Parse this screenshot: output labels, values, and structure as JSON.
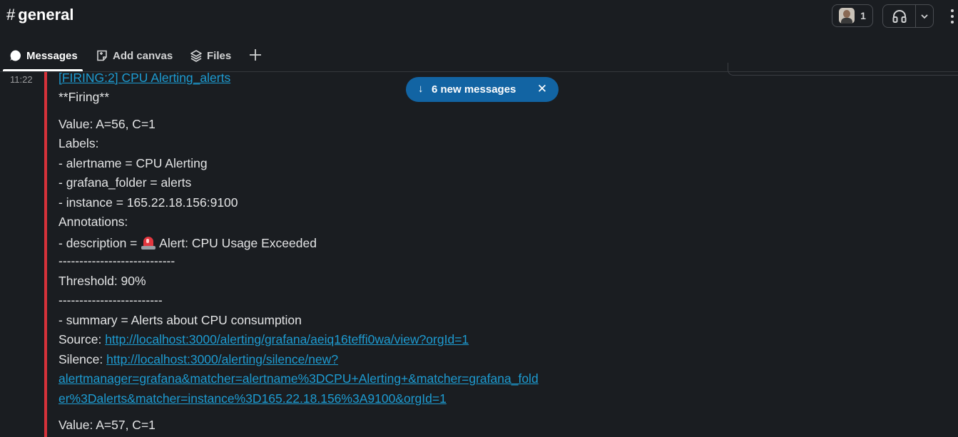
{
  "header": {
    "channel_hash": "#",
    "channel_name": "general",
    "member_count": "1"
  },
  "tabs": [
    {
      "label": "Messages",
      "icon": "message-bubble-icon",
      "active": true
    },
    {
      "label": "Add canvas",
      "icon": "canvas-icon",
      "active": false
    },
    {
      "label": "Files",
      "icon": "files-stack-icon",
      "active": false
    }
  ],
  "new_messages_pill": {
    "arrow": "↓",
    "label": "6 new messages",
    "close": "✕"
  },
  "message": {
    "timestamp": "11:22",
    "title": "[FIRING:2] CPU Alerting_alerts",
    "firing": "**Firing**",
    "value1": "Value: A=56, C=1",
    "labels_heading": "Labels:",
    "label_alertname": "- alertname = CPU Alerting",
    "label_folder": "- grafana_folder = alerts",
    "label_instance": "- instance = 165.22.18.156:9100",
    "annotations_heading": "Annotations:",
    "description_prefix": "- description = ",
    "description_text": " Alert: CPU Usage Exceeded",
    "divider1": "----------------------------",
    "threshold": "Threshold: 90%",
    "divider2": "-------------------------",
    "summary": "- summary = Alerts about CPU consumption",
    "source_label": "Source: ",
    "source_url": "http://localhost:3000/alerting/grafana/aeiq16teffi0wa/view?orgId=1",
    "silence_label": "Silence: ",
    "silence_url_1": "http://localhost:3000/alerting/silence/new?",
    "silence_url_2": "alertmanager=grafana&matcher=alertname%3DCPU+Alerting+&matcher=grafana_fold",
    "silence_url_3": "er%3Dalerts&matcher=instance%3D165.22.18.156%3A9100&orgId=1",
    "value2": "Value: A=57, C=1"
  },
  "colors": {
    "background": "#1a1d21",
    "link": "#1d9bd1",
    "attachment_bar": "#d6323a",
    "pill": "#1264a3"
  }
}
